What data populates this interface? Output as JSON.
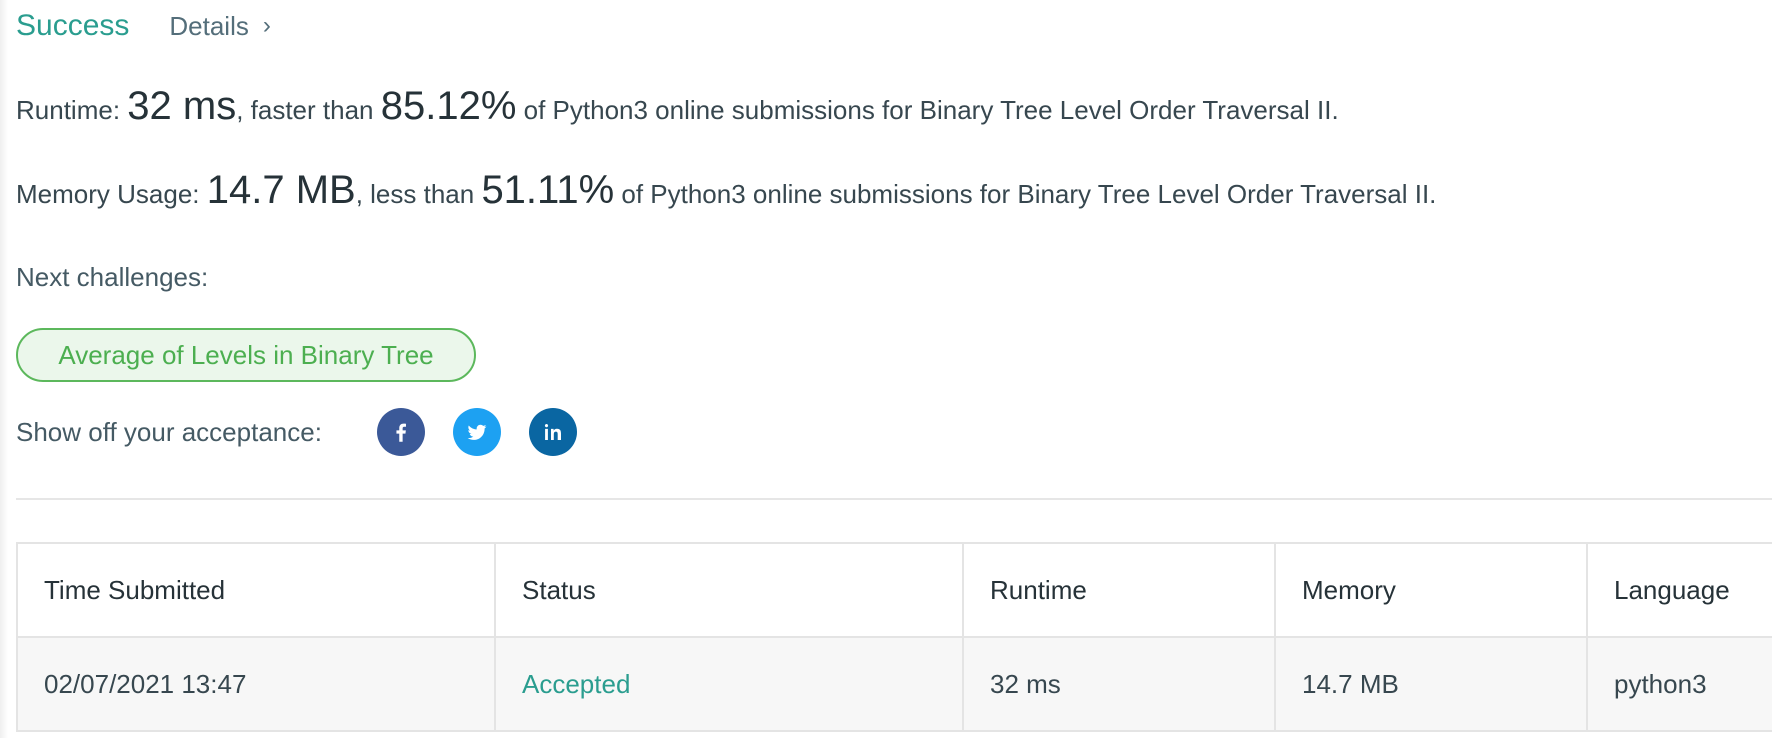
{
  "header": {
    "status": "Success",
    "details_label": "Details",
    "chevron": "›"
  },
  "runtime_line": {
    "label": "Runtime: ",
    "value": "32 ms",
    "comparison": ", faster than ",
    "percent": "85.12%",
    "suffix": " of Python3 online submissions for Binary Tree Level Order Traversal II."
  },
  "memory_line": {
    "label": "Memory Usage: ",
    "value": "14.7 MB",
    "comparison": ", less than ",
    "percent": "51.11%",
    "suffix": " of Python3 online submissions for Binary Tree Level Order Traversal II."
  },
  "next": {
    "label": "Next challenges:",
    "challenges": [
      "Average of Levels in Binary Tree"
    ]
  },
  "share": {
    "label": "Show off your acceptance:",
    "icons": [
      "facebook-icon",
      "twitter-icon",
      "linkedin-icon"
    ]
  },
  "table": {
    "headers": [
      "Time Submitted",
      "Status",
      "Runtime",
      "Memory",
      "Language"
    ],
    "rows": [
      [
        "02/07/2021 13:47",
        "Accepted",
        "32 ms",
        "14.7 MB",
        "python3"
      ]
    ]
  },
  "colors": {
    "success": "#2a9d8f",
    "challenge_green": "#4caf50",
    "facebook": "#3b5998",
    "twitter": "#1da1f2",
    "linkedin": "#0a66a2"
  }
}
